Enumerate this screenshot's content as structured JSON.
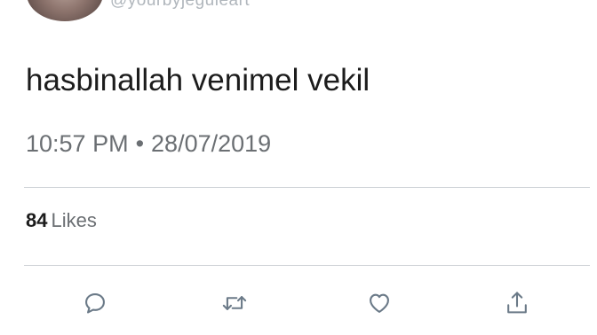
{
  "tweet": {
    "handle": "@yourbyjeguleart",
    "text": "hasbinallah venimel vekil",
    "time": "10:57 PM",
    "separator": "•",
    "date": "28/07/2019"
  },
  "stats": {
    "likes_count": "84",
    "likes_label": "Likes"
  },
  "actions": [
    {
      "name": "reply",
      "icon": "reply-icon"
    },
    {
      "name": "retweet",
      "icon": "retweet-icon"
    },
    {
      "name": "like",
      "icon": "heart-icon"
    },
    {
      "name": "share",
      "icon": "share-icon"
    }
  ],
  "colors": {
    "text": "#1c1c1c",
    "secondary": "#6b6f73",
    "divider": "#cfd3d7",
    "icon": "#6b7a88"
  }
}
